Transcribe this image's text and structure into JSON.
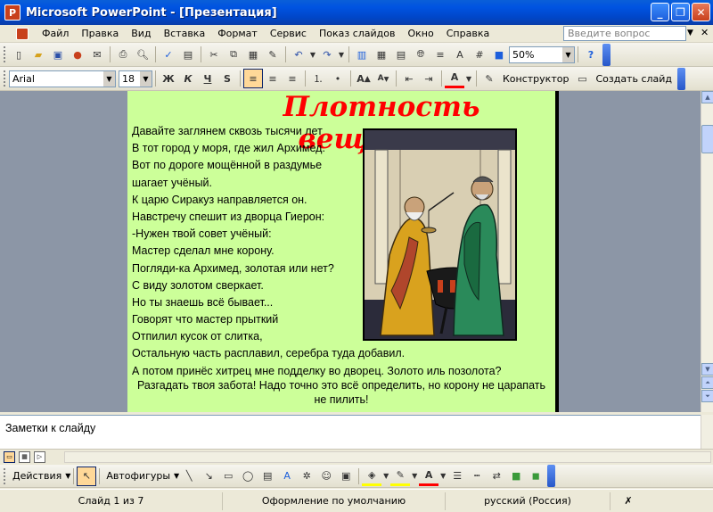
{
  "window": {
    "title": "Microsoft PowerPoint - [Презентация]"
  },
  "menu": {
    "items": [
      "Файл",
      "Правка",
      "Вид",
      "Вставка",
      "Формат",
      "Сервис",
      "Показ слайдов",
      "Окно",
      "Справка"
    ],
    "ask_placeholder": "Введите вопрос"
  },
  "standard_toolbar": {
    "zoom": "50%"
  },
  "formatting_toolbar": {
    "font": "Arial",
    "size": "18",
    "bold": "Ж",
    "italic": "К",
    "underline": "Ч",
    "shadow": "S",
    "designer": "Конструктор",
    "new_slide": "Создать слайд"
  },
  "slide": {
    "title": "Плотность вещества",
    "lines": [
      "Давайте заглянем сквозь тысячи лет",
      "В тот город у моря, где жил Архимед.",
      "Вот по дороге мощённой в раздумье",
      "шагает учёный.",
      "К царю Сиракуз направляется он.",
      "Навстречу спешит из дворца Гиерон:",
      "-Нужен твой совет учёный:",
      "Мастер сделал мне корону.",
      "Погляди-ка Архимед, золотая или нет?",
      "С виду золотом сверкает.",
      "Но ты знаешь всё бывает...",
      "Говорят что мастер прыткий",
      "Отпилил кусок от слитка,",
      "Остальную часть расплавил, серебра туда добавил.",
      "А потом принёс хитрец мне подделку во дворец. Золото иль позолота?"
    ],
    "closing": "Разгадать твоя забота! Надо точно это всё определить, но корону не царапать не пилить!"
  },
  "notes": {
    "placeholder": "Заметки к слайду"
  },
  "drawing_toolbar": {
    "actions": "Действия",
    "autoshapes": "Автофигуры"
  },
  "status": {
    "slide": "Слайд 1 из 7",
    "design": "Оформление по умолчанию",
    "language": "русский (Россия)"
  },
  "colors": {
    "slide_bg": "#ccff99",
    "title": "#ff0000",
    "workspace": "#8c96a6"
  }
}
